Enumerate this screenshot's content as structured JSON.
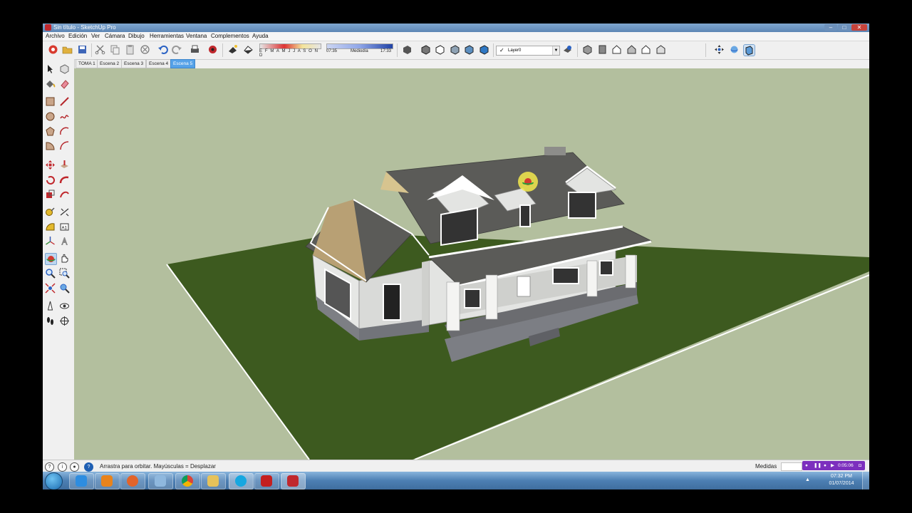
{
  "window": {
    "title": "Sin título - SketchUp Pro"
  },
  "menu": [
    "Archivo",
    "Edición",
    "Ver",
    "Cámara",
    "Dibujo",
    "Herramientas",
    "Ventana",
    "Complementos",
    "Ayuda"
  ],
  "shadow": {
    "months": "E F M A M J J A S O N D",
    "time_start": "07:35",
    "time_mid": "Mediodía",
    "time_end": "17:33"
  },
  "layer": {
    "name": "Layer0"
  },
  "scenes": [
    {
      "label": "TOMA 1",
      "active": false
    },
    {
      "label": "Escena 2",
      "active": false
    },
    {
      "label": "Escena 3",
      "active": false
    },
    {
      "label": "Escena 4",
      "active": false
    },
    {
      "label": "Escena 5",
      "active": true
    }
  ],
  "status": {
    "message": "Arrastra para orbitar. Mayúsculas = Desplazar",
    "measurements_label": "Medidas",
    "recorder_time": "0:05:06"
  },
  "taskbar": {
    "apps": [
      "internet-explorer",
      "media-player",
      "firefox",
      "remote-desktop",
      "chrome",
      "file-explorer",
      "skype",
      "acrobat",
      "sketchup"
    ],
    "time": "07:32 PM",
    "date": "01/07/2014"
  },
  "colors": {
    "sky": "#b3bf9e",
    "lawn": "#3d5a1f",
    "roof": "#5b5b58",
    "siding": "#e3e4e2",
    "active_tab": "#56a2e8",
    "recorder": "#7c2fbe"
  }
}
